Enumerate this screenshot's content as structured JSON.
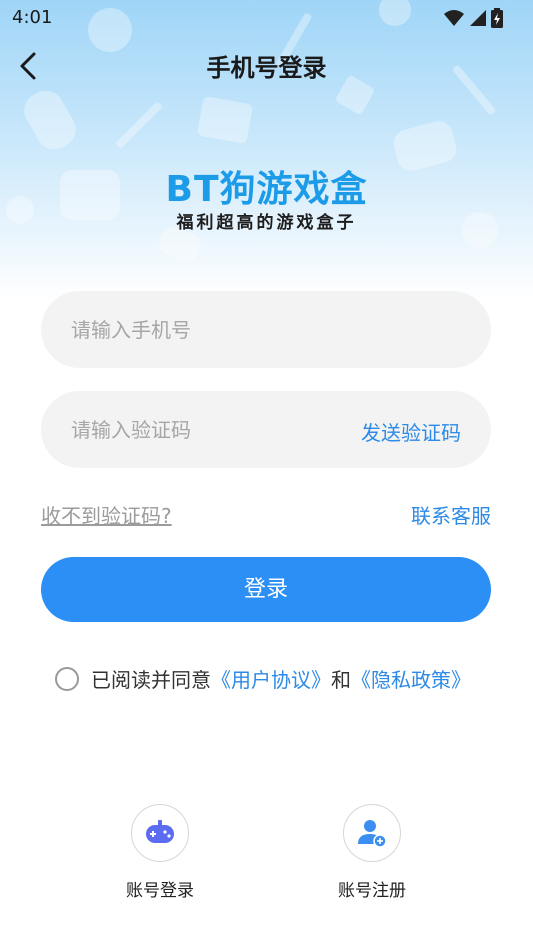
{
  "status_bar": {
    "time": "4:01"
  },
  "header": {
    "title": "手机号登录"
  },
  "brand": {
    "logo_text": "BT狗游戏盒",
    "slogan": "福利超高的游戏盒子"
  },
  "form": {
    "phone_placeholder": "请输入手机号",
    "code_placeholder": "请输入验证码",
    "send_code_label": "发送验证码",
    "help_link": "收不到验证码?",
    "service_link": "联系客服",
    "login_button": "登录"
  },
  "agreement": {
    "prefix": "已阅读并同意",
    "user_agreement": "《用户协议》",
    "and": "和",
    "privacy_policy": "《隐私政策》"
  },
  "bottom_actions": [
    {
      "label": "账号登录",
      "icon": "gamepad-icon"
    },
    {
      "label": "账号注册",
      "icon": "add-user-icon"
    }
  ],
  "colors": {
    "accent": "#2b8ff5",
    "link": "#2d8ae6",
    "logo": "#1b9be8"
  }
}
